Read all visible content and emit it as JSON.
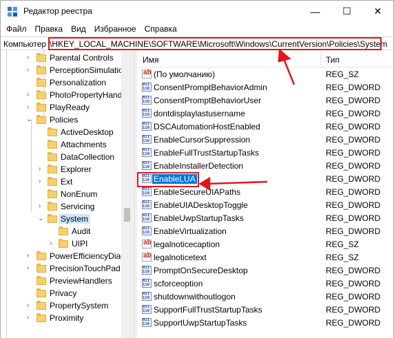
{
  "window": {
    "title": "Редактор реестра",
    "controls": {
      "minimize": "—",
      "maximize": "☐",
      "close": "✕"
    }
  },
  "menu": [
    "Файл",
    "Правка",
    "Вид",
    "Избранное",
    "Справка"
  ],
  "address": {
    "label": "Компьютер",
    "path": "\\HKEY_LOCAL_MACHINE\\SOFTWARE\\Microsoft\\Windows\\CurrentVersion\\Policies\\System"
  },
  "tree": [
    {
      "label": "Parental Controls"
    },
    {
      "label": "PerceptionSimulatio"
    },
    {
      "label": "Personalization"
    },
    {
      "label": "PhotoPropertyHand"
    },
    {
      "label": "PlayReady"
    },
    {
      "label": "Policies"
    },
    {
      "label": "ActiveDesktop"
    },
    {
      "label": "Attachments"
    },
    {
      "label": "DataCollection"
    },
    {
      "label": "Explorer"
    },
    {
      "label": "Ext"
    },
    {
      "label": "NonEnum"
    },
    {
      "label": "Servicing"
    },
    {
      "label": "System"
    },
    {
      "label": "Audit"
    },
    {
      "label": "UIPI"
    },
    {
      "label": "PowerEfficiencyDiag"
    },
    {
      "label": "PrecisionTouchPad"
    },
    {
      "label": "PreviewHandlers"
    },
    {
      "label": "Privacy"
    },
    {
      "label": "PropertySystem"
    },
    {
      "label": "Proximity"
    }
  ],
  "list": {
    "headers": {
      "name": "Имя",
      "type": "Тип"
    },
    "rows": [
      {
        "name": "(По умолчанию)",
        "type": "REG_SZ",
        "icon": "string-value-icon"
      },
      {
        "name": "ConsentPromptBehaviorAdmin",
        "type": "REG_DWORD",
        "icon": "dword-value-icon"
      },
      {
        "name": "ConsentPromptBehaviorUser",
        "type": "REG_DWORD",
        "icon": "dword-value-icon"
      },
      {
        "name": "dontdisplaylastusername",
        "type": "REG_DWORD",
        "icon": "dword-value-icon"
      },
      {
        "name": "DSCAutomationHostEnabled",
        "type": "REG_DWORD",
        "icon": "dword-value-icon"
      },
      {
        "name": "EnableCursorSuppression",
        "type": "REG_DWORD",
        "icon": "dword-value-icon"
      },
      {
        "name": "EnableFullTrustStartupTasks",
        "type": "REG_DWORD",
        "icon": "dword-value-icon"
      },
      {
        "name": "EnableInstallerDetection",
        "type": "REG_DWORD",
        "icon": "dword-value-icon"
      },
      {
        "name": "EnableLUA",
        "type": "REG_DWORD",
        "icon": "dword-value-icon"
      },
      {
        "name": "EnableSecureUIAPaths",
        "type": "REG_DWORD",
        "icon": "dword-value-icon"
      },
      {
        "name": "EnableUIADesktopToggle",
        "type": "REG_DWORD",
        "icon": "dword-value-icon"
      },
      {
        "name": "EnableUwpStartupTasks",
        "type": "REG_DWORD",
        "icon": "dword-value-icon"
      },
      {
        "name": "EnableVirtualization",
        "type": "REG_DWORD",
        "icon": "dword-value-icon"
      },
      {
        "name": "legalnoticecaption",
        "type": "REG_SZ",
        "icon": "string-value-icon"
      },
      {
        "name": "legalnoticetext",
        "type": "REG_SZ",
        "icon": "string-value-icon"
      },
      {
        "name": "PromptOnSecureDesktop",
        "type": "REG_DWORD",
        "icon": "dword-value-icon"
      },
      {
        "name": "scforceoption",
        "type": "REG_DWORD",
        "icon": "dword-value-icon"
      },
      {
        "name": "shutdownwithoutlogon",
        "type": "REG_DWORD",
        "icon": "dword-value-icon"
      },
      {
        "name": "SupportFullTrustStartupTasks",
        "type": "REG_DWORD",
        "icon": "dword-value-icon"
      },
      {
        "name": "SupportUwpStartupTasks",
        "type": "REG_DWORD",
        "icon": "dword-value-icon"
      }
    ]
  },
  "colors": {
    "highlight_annotation": "#e0161c",
    "selected_row": "#0078d7",
    "selected_tree": "#cce8ff"
  }
}
